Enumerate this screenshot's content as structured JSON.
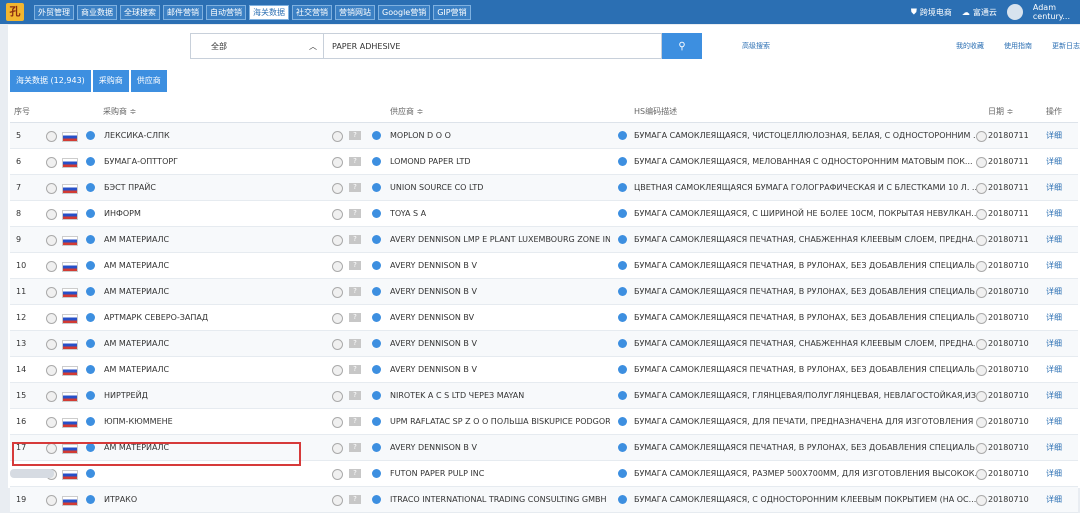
{
  "nav": [
    "外贸管理",
    "商业数据",
    "全球搜索",
    "邮件营销",
    "自动营销",
    "海关数据",
    "社交营销",
    "营销网站",
    "Google营销",
    "GIP营销"
  ],
  "nav_active": 5,
  "topright": {
    "cross_border": "跨境电商",
    "fuying": "富通云",
    "user_name": "Adam",
    "user_sub": "century..."
  },
  "search": {
    "scope": "全部",
    "query": "PAPER ADHESIVE",
    "advanced": "高级搜索",
    "links": [
      "我的收藏",
      "使用指南",
      "更新日志"
    ]
  },
  "tabs": [
    "海关数据 (12,943)",
    "采购商",
    "供应商"
  ],
  "headers": {
    "no": "序号",
    "buyer": "采购商 ≑",
    "supplier": "供应商 ≑",
    "hs": "HS编码描述",
    "date": "日期 ≑",
    "op": "操作"
  },
  "rows": [
    {
      "no": "5",
      "buyer": "ЛЕКСИКА-СЛПК",
      "supplier": "MOPLON D O O",
      "hs": "БУМАГА САМОКЛЕЯЩАЯСЯ, ЧИСТОЦЕЛЛЮЛОЗНАЯ, БЕЛАЯ, С ОДНОСТОРОННИМ ...",
      "date": "20180711",
      "op": "详细"
    },
    {
      "no": "6",
      "buyer": "БУМАГА-ОПТТОРГ",
      "supplier": "LOMOND PAPER LTD",
      "hs": "БУМАГА САМОКЛЕЯЩАЯСЯ, МЕЛОВАННАЯ С ОДНОСТОРОННИМ МАТОВЫМ ПОК...",
      "date": "20180711",
      "op": "详细"
    },
    {
      "no": "7",
      "buyer": "БЭСТ ПРАЙС",
      "supplier": "UNION SOURCE CO LTD",
      "hs": "ЦВЕТНАЯ САМОКЛЕЯЩАЯСЯ БУМАГА ГОЛОГРАФИЧЕСКАЯ И С БЛЕСТКАМИ 10 Л. ...",
      "date": "20180711",
      "op": "详细"
    },
    {
      "no": "8",
      "buyer": "ИНФОРМ",
      "supplier": "TOYA S A",
      "hs": "БУМАГА САМОКЛЕЯЩАЯСЯ, С ШИРИНОЙ НЕ БОЛЕЕ 10СМ, ПОКРЫТАЯ НЕВУЛКАН...",
      "date": "20180711",
      "op": "详细"
    },
    {
      "no": "9",
      "buyer": "АМ МАТЕРИАЛС",
      "supplier": "AVERY DENNISON LMP E PLANT LUXEMBOURG ZONE IN",
      "hs": "БУМАГА САМОКЛЕЯЩАЯСЯ ПЕЧАТНАЯ, СНАБЖЕННАЯ КЛЕЕВЫМ СЛОЕМ, ПРЕДНА...",
      "date": "20180711",
      "op": "详细"
    },
    {
      "no": "10",
      "buyer": "АМ МАТЕРИАЛС",
      "supplier": "AVERY DENNISON B V",
      "hs": "БУМАГА САМОКЛЕЯЩАЯСЯ ПЕЧАТНАЯ, В РУЛОНАХ, БЕЗ ДОБАВЛЕНИЯ СПЕЦИАЛЬ...",
      "date": "20180710",
      "op": "详细"
    },
    {
      "no": "11",
      "buyer": "АМ МАТЕРИАЛС",
      "supplier": "AVERY DENNISON B V",
      "hs": "БУМАГА САМОКЛЕЯЩАЯСЯ ПЕЧАТНАЯ, В РУЛОНАХ, БЕЗ ДОБАВЛЕНИЯ СПЕЦИАЛЬ...",
      "date": "20180710",
      "op": "详细"
    },
    {
      "no": "12",
      "buyer": "АРТМАРК СЕВЕРО-ЗАПАД",
      "supplier": "AVERY DENNISON BV",
      "hs": "БУМАГА САМОКЛЕЯЩАЯСЯ ПЕЧАТНАЯ, В РУЛОНАХ, БЕЗ ДОБАВЛЕНИЯ СПЕЦИАЛЬ...",
      "date": "20180710",
      "op": "详细"
    },
    {
      "no": "13",
      "buyer": "АМ МАТЕРИАЛС",
      "supplier": "AVERY DENNISON B V",
      "hs": "БУМАГА САМОКЛЕЯЩАЯСЯ ПЕЧАТНАЯ, СНАБЖЕННАЯ КЛЕЕВЫМ СЛОЕМ, ПРЕДНА...",
      "date": "20180710",
      "op": "详细"
    },
    {
      "no": "14",
      "buyer": "АМ МАТЕРИАЛС",
      "supplier": "AVERY DENNISON B V",
      "hs": "БУМАГА САМОКЛЕЯЩАЯСЯ ПЕЧАТНАЯ, В РУЛОНАХ, БЕЗ ДОБАВЛЕНИЯ СПЕЦИАЛЬ...",
      "date": "20180710",
      "op": "详细"
    },
    {
      "no": "15",
      "buyer": "НИРТРЕЙД",
      "supplier": "NIROTEK A C S LTD ЧЕРЕЗ MAYAN",
      "hs": "БУМАГА САМОКЛЕЯЩАЯСЯ, ГЛЯНЦЕВАЯ/ПОЛУГЛЯНЦЕВАЯ, НЕВЛАГОСТОЙКАЯ,ИЗ...",
      "date": "20180710",
      "op": "详细"
    },
    {
      "no": "16",
      "buyer": "ЮПМ-КЮММЕНЕ",
      "supplier": "UPM RAFLATAC SP Z O O ПОЛЬША BISKUPICE PODGOR",
      "hs": "БУМАГА САМОКЛЕЯЩАЯСЯ, ДЛЯ ПЕЧАТИ, ПРЕДНАЗНАЧЕНА ДЛЯ ИЗГОТОВЛЕНИЯ ...",
      "date": "20180710",
      "op": "详细"
    },
    {
      "no": "17",
      "buyer": "АМ МАТЕРИАЛС",
      "supplier": "AVERY DENNISON B V",
      "hs": "БУМАГА САМОКЛЕЯЩАЯСЯ ПЕЧАТНАЯ, В РУЛОНАХ, БЕЗ ДОБАВЛЕНИЯ СПЕЦИАЛЬ...",
      "date": "20180710",
      "op": "详细"
    },
    {
      "no": "18",
      "buyer": "",
      "supplier": "FUTON PAPER PULP INC",
      "hs": "БУМАГА САМОКЛЕЯЩАЯСЯ, РАЗМЕР 500Х700ММ, ДЛЯ ИЗГОТОВЛЕНИЯ ВЫСОКОК...",
      "date": "20180710",
      "op": "详细"
    },
    {
      "no": "19",
      "buyer": "ИТРАКО",
      "supplier": "ITRACO INTERNATIONAL TRADING CONSULTING GMBH",
      "hs": "БУМАГА САМОКЛЕЯЩАЯСЯ, С ОДНОСТОРОННИМ КЛЕЕВЫМ ПОКРЫТИЕМ (НА ОС...",
      "date": "20180710",
      "op": "详细"
    }
  ]
}
